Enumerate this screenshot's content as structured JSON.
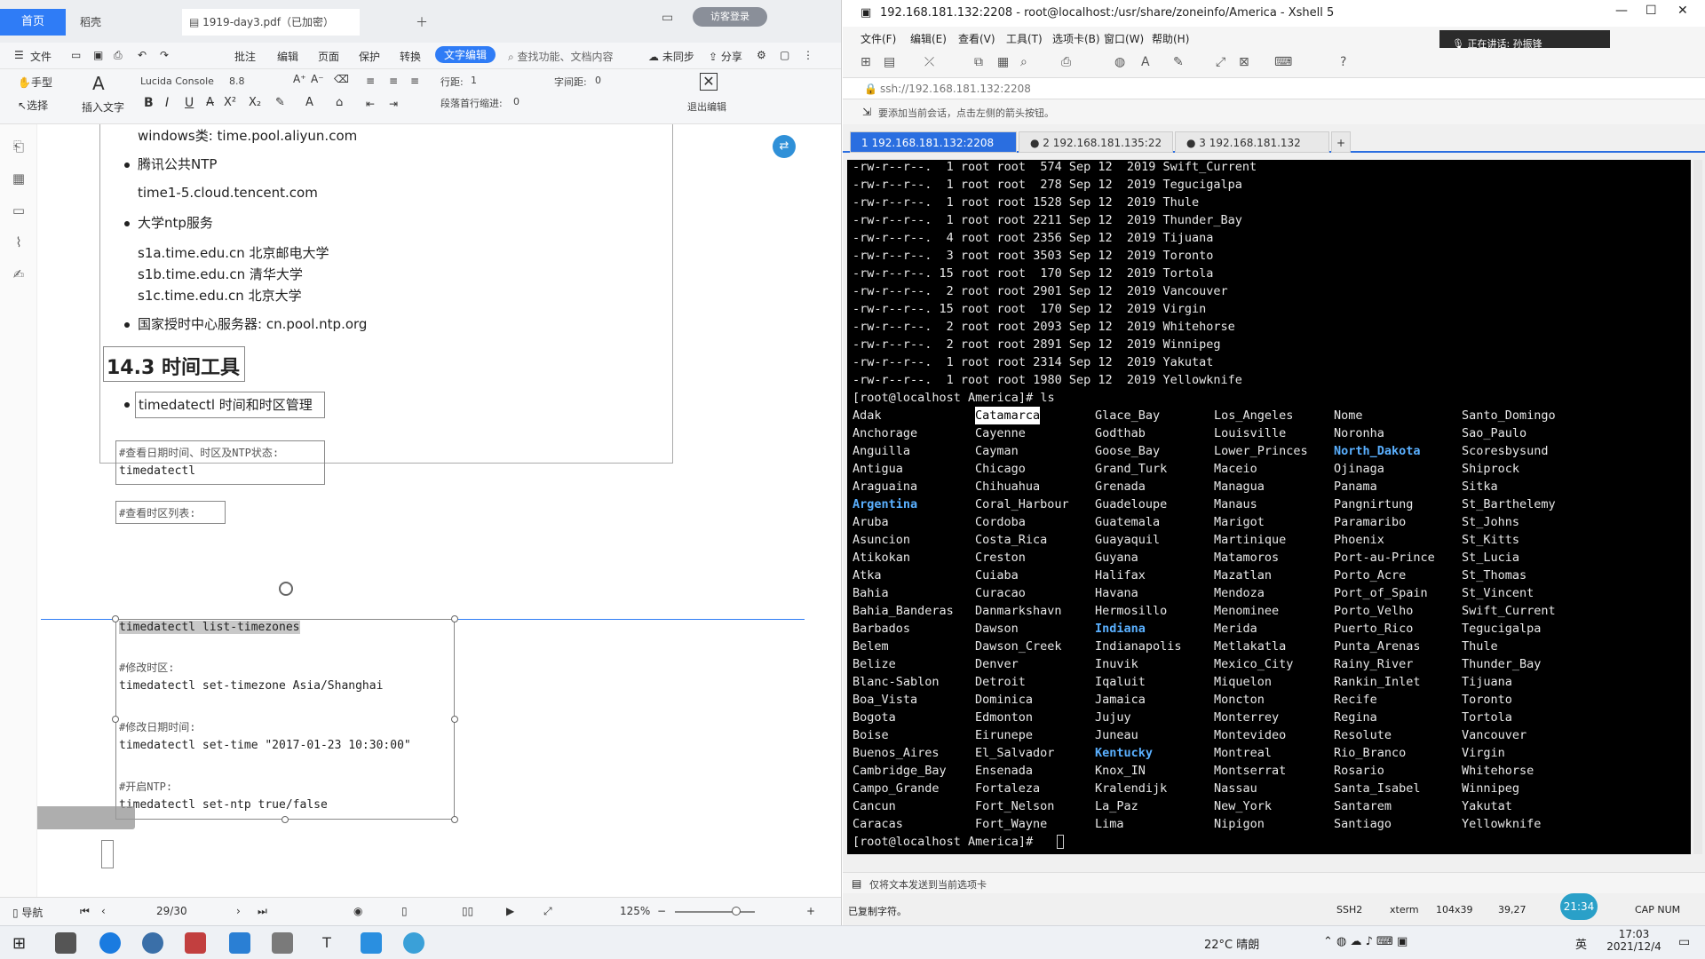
{
  "pdf_app": {
    "tabs": {
      "home": "首页",
      "draft": "稻壳",
      "doc": "1919-day3.pdf（已加密）"
    },
    "guest_label": "访客登录",
    "menu": [
      "文件",
      "批注",
      "编辑",
      "页面",
      "保护",
      "转换",
      "文字编辑"
    ],
    "search_placeholder": "查找功能、文档内容",
    "menu_right": {
      "unsync": "未同步",
      "share": "分享"
    },
    "toolbar": {
      "hand": "手型",
      "select": "选择",
      "insert_text": "插入文字",
      "font": "Lucida Console",
      "font_size": "8.8",
      "line_spacing_label": "行距:",
      "line_spacing_value": "1",
      "char_spacing_label": "字间距:",
      "char_spacing_value": "0",
      "indent_label": "段落首行缩进:",
      "indent_value": "0",
      "exit_edit": "退出编辑"
    },
    "document": {
      "windows_line": "windows类:  time.pool.aliyun.com",
      "tencent_title": "腾讯公共NTP",
      "tencent_host": "time1-5.cloud.tencent.com",
      "univ_title": "大学ntp服务",
      "univ_1": "s1a.time.edu.cn 北京邮电大学",
      "univ_2": "s1b.time.edu.cn 清华大学",
      "univ_3": "s1c.time.edu.cn 北京大学",
      "national": "国家授时中心服务器:  cn.pool.ntp.org",
      "section_title": "14.3 时间工具",
      "timedatectl_desc": "timedatectl 时间和时区管理",
      "comment_status": "#查看日期时间、时区及NTP状态:",
      "cmd_status": "timedatectl",
      "comment_list": "#查看时区列表:",
      "cmd_list": "timedatectl list-timezones",
      "comment_set_tz": "#修改时区:",
      "cmd_set_tz": "timedatectl set-timezone Asia/Shanghai",
      "comment_set_time": "#修改日期时间:",
      "cmd_set_time": "timedatectl set-time \"2017-01-23 10:30:00\"",
      "comment_ntp": "#开启NTP:",
      "cmd_ntp": "timedatectl set-ntp true/false"
    },
    "status": {
      "nav": "导航",
      "page": "29/30",
      "zoom": "125%"
    }
  },
  "xshell": {
    "title": "192.168.181.132:2208 - root@localhost:/usr/share/zoneinfo/America - Xshell 5",
    "menu": [
      "文件(F)",
      "编辑(E)",
      "查看(V)",
      "工具(T)",
      "选项卡(B)",
      "窗口(W)",
      "帮助(H)"
    ],
    "speaking": "正在讲话: 孙振锋",
    "address": "ssh://192.168.181.132:2208",
    "note": "要添加当前会话，点击左侧的箭头按钮。",
    "tabs": [
      "1 192.168.181.132:2208",
      "2 192.168.181.135:22",
      "3 192.168.181.132"
    ],
    "listing": [
      "-rw-r--r--.  1 root root  574 Sep 12  2019 Swift_Current",
      "-rw-r--r--.  1 root root  278 Sep 12  2019 Tegucigalpa",
      "-rw-r--r--.  1 root root 1528 Sep 12  2019 Thule",
      "-rw-r--r--.  1 root root 2211 Sep 12  2019 Thunder_Bay",
      "-rw-r--r--.  4 root root 2356 Sep 12  2019 Tijuana",
      "-rw-r--r--.  3 root root 3503 Sep 12  2019 Toronto",
      "-rw-r--r--. 15 root root  170 Sep 12  2019 Tortola",
      "-rw-r--r--.  2 root root 2901 Sep 12  2019 Vancouver",
      "-rw-r--r--. 15 root root  170 Sep 12  2019 Virgin",
      "-rw-r--r--.  2 root root 2093 Sep 12  2019 Whitehorse",
      "-rw-r--r--.  2 root root 2891 Sep 12  2019 Winnipeg",
      "-rw-r--r--.  1 root root 2314 Sep 12  2019 Yakutat",
      "-rw-r--r--.  1 root root 1980 Sep 12  2019 Yellowknife"
    ],
    "prompt_ls": "[root@localhost America]# ls",
    "columns": [
      [
        "Adak",
        "Anchorage",
        "Anguilla",
        "Antigua",
        "Araguaina",
        "Argentina",
        "Aruba",
        "Asuncion",
        "Atikokan",
        "Atka",
        "Bahia",
        "Bahia_Banderas",
        "Barbados",
        "Belem",
        "Belize",
        "Blanc-Sablon",
        "Boa_Vista",
        "Bogota",
        "Boise",
        "Buenos_Aires",
        "Cambridge_Bay",
        "Campo_Grande",
        "Cancun",
        "Caracas"
      ],
      [
        "Catamarca",
        "Cayenne",
        "Cayman",
        "Chicago",
        "Chihuahua",
        "Coral_Harbour",
        "Cordoba",
        "Costa_Rica",
        "Creston",
        "Cuiaba",
        "Curacao",
        "Danmarkshavn",
        "Dawson",
        "Dawson_Creek",
        "Denver",
        "Detroit",
        "Dominica",
        "Edmonton",
        "Eirunepe",
        "El_Salvador",
        "Ensenada",
        "Fortaleza",
        "Fort_Nelson",
        "Fort_Wayne"
      ],
      [
        "Glace_Bay",
        "Godthab",
        "Goose_Bay",
        "Grand_Turk",
        "Grenada",
        "Guadeloupe",
        "Guatemala",
        "Guayaquil",
        "Guyana",
        "Halifax",
        "Havana",
        "Hermosillo",
        "Indiana",
        "Indianapolis",
        "Inuvik",
        "Iqaluit",
        "Jamaica",
        "Jujuy",
        "Juneau",
        "Kentucky",
        "Knox_IN",
        "Kralendijk",
        "La_Paz",
        "Lima"
      ],
      [
        "Los_Angeles",
        "Louisville",
        "Lower_Princes",
        "Maceio",
        "Managua",
        "Manaus",
        "Marigot",
        "Martinique",
        "Matamoros",
        "Mazatlan",
        "Mendoza",
        "Menominee",
        "Merida",
        "Metlakatla",
        "Mexico_City",
        "Miquelon",
        "Moncton",
        "Monterrey",
        "Montevideo",
        "Montreal",
        "Montserrat",
        "Nassau",
        "New_York",
        "Nipigon"
      ],
      [
        "Nome",
        "Noronha",
        "North_Dakota",
        "Ojinaga",
        "Panama",
        "Pangnirtung",
        "Paramaribo",
        "Phoenix",
        "Port-au-Prince",
        "Porto_Acre",
        "Port_of_Spain",
        "Porto_Velho",
        "Puerto_Rico",
        "Punta_Arenas",
        "Rainy_River",
        "Rankin_Inlet",
        "Recife",
        "Regina",
        "Resolute",
        "Rio_Branco",
        "Rosario",
        "Santa_Isabel",
        "Santarem",
        "Santiago"
      ],
      [
        "Santo_Domingo",
        "Sao_Paulo",
        "Scoresbysund",
        "Shiprock",
        "Sitka",
        "St_Barthelemy",
        "St_Johns",
        "St_Kitts",
        "St_Lucia",
        "St_Thomas",
        "St_Vincent",
        "Swift_Current",
        "Tegucigalpa",
        "Thule",
        "Thunder_Bay",
        "Tijuana",
        "Toronto",
        "Tortola",
        "Vancouver",
        "Virgin",
        "Whitehorse",
        "Winnipeg",
        "Yakutat",
        "Yellowknife"
      ]
    ],
    "dirs": [
      "Argentina",
      "Indiana",
      "Kentucky",
      "North_Dakota"
    ],
    "highlighted": "Catamarca",
    "prompt_end": "[root@localhost America]# ",
    "send_note": "仅将文本发送到当前选项卡",
    "status_left": "已复制字符。",
    "status": {
      "proto": "SSH2",
      "term": "xterm",
      "size": "104x39",
      "pos": "39,27",
      "caps": "CAP NUM"
    },
    "timer": "21:34"
  },
  "taskbar": {
    "weather": "22°C 晴朗",
    "ime": "英",
    "time": "17:03",
    "date": "2021/12/4"
  }
}
